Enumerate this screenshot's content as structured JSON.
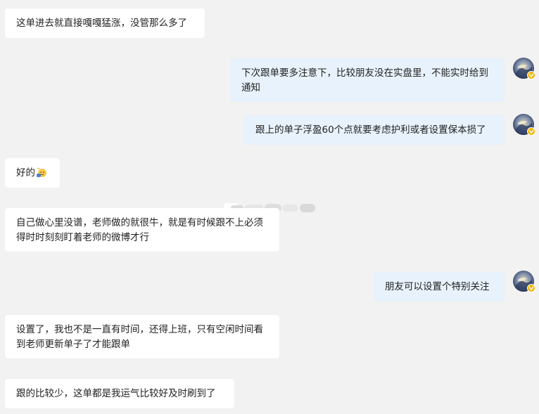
{
  "messages": [
    {
      "side": "left",
      "text": "这单进去就直接嘎嘎猛涨，没管那么多了"
    },
    {
      "side": "right",
      "text": "下次跟单要多注意下，比较朋友没在实盘里，不能实时给到通知"
    },
    {
      "side": "right",
      "text": "跟上的单子浮盈60个点就要考虑护利或者设置保本损了"
    },
    {
      "side": "left",
      "text": "好的",
      "emoji": "waving-hand-emoji"
    },
    {
      "side": "left",
      "text": "自己做心里没谱，老师做的就很牛，就是有时候跟不上必须得时时刻刻盯着老师的微博才行"
    },
    {
      "side": "right",
      "text": "朋友可以设置个特别关注"
    },
    {
      "side": "left",
      "text": "设置了，我也不是一直有时间，还得上班，只有空闲时间看到老师更新单子了才能跟单"
    },
    {
      "side": "left",
      "text": "跟的比较少，这单都是我运气比较好及时刷到了"
    }
  ],
  "colors": {
    "background": "#f2f2f2",
    "left_bubble": "#ffffff",
    "right_bubble": "#e8f2fc",
    "text": "#222222",
    "verified_badge": "#f5b400"
  },
  "icons": {
    "avatar": "user-avatar",
    "badge": "verified-badge-icon",
    "emoji": "waving-hand-emoji"
  }
}
